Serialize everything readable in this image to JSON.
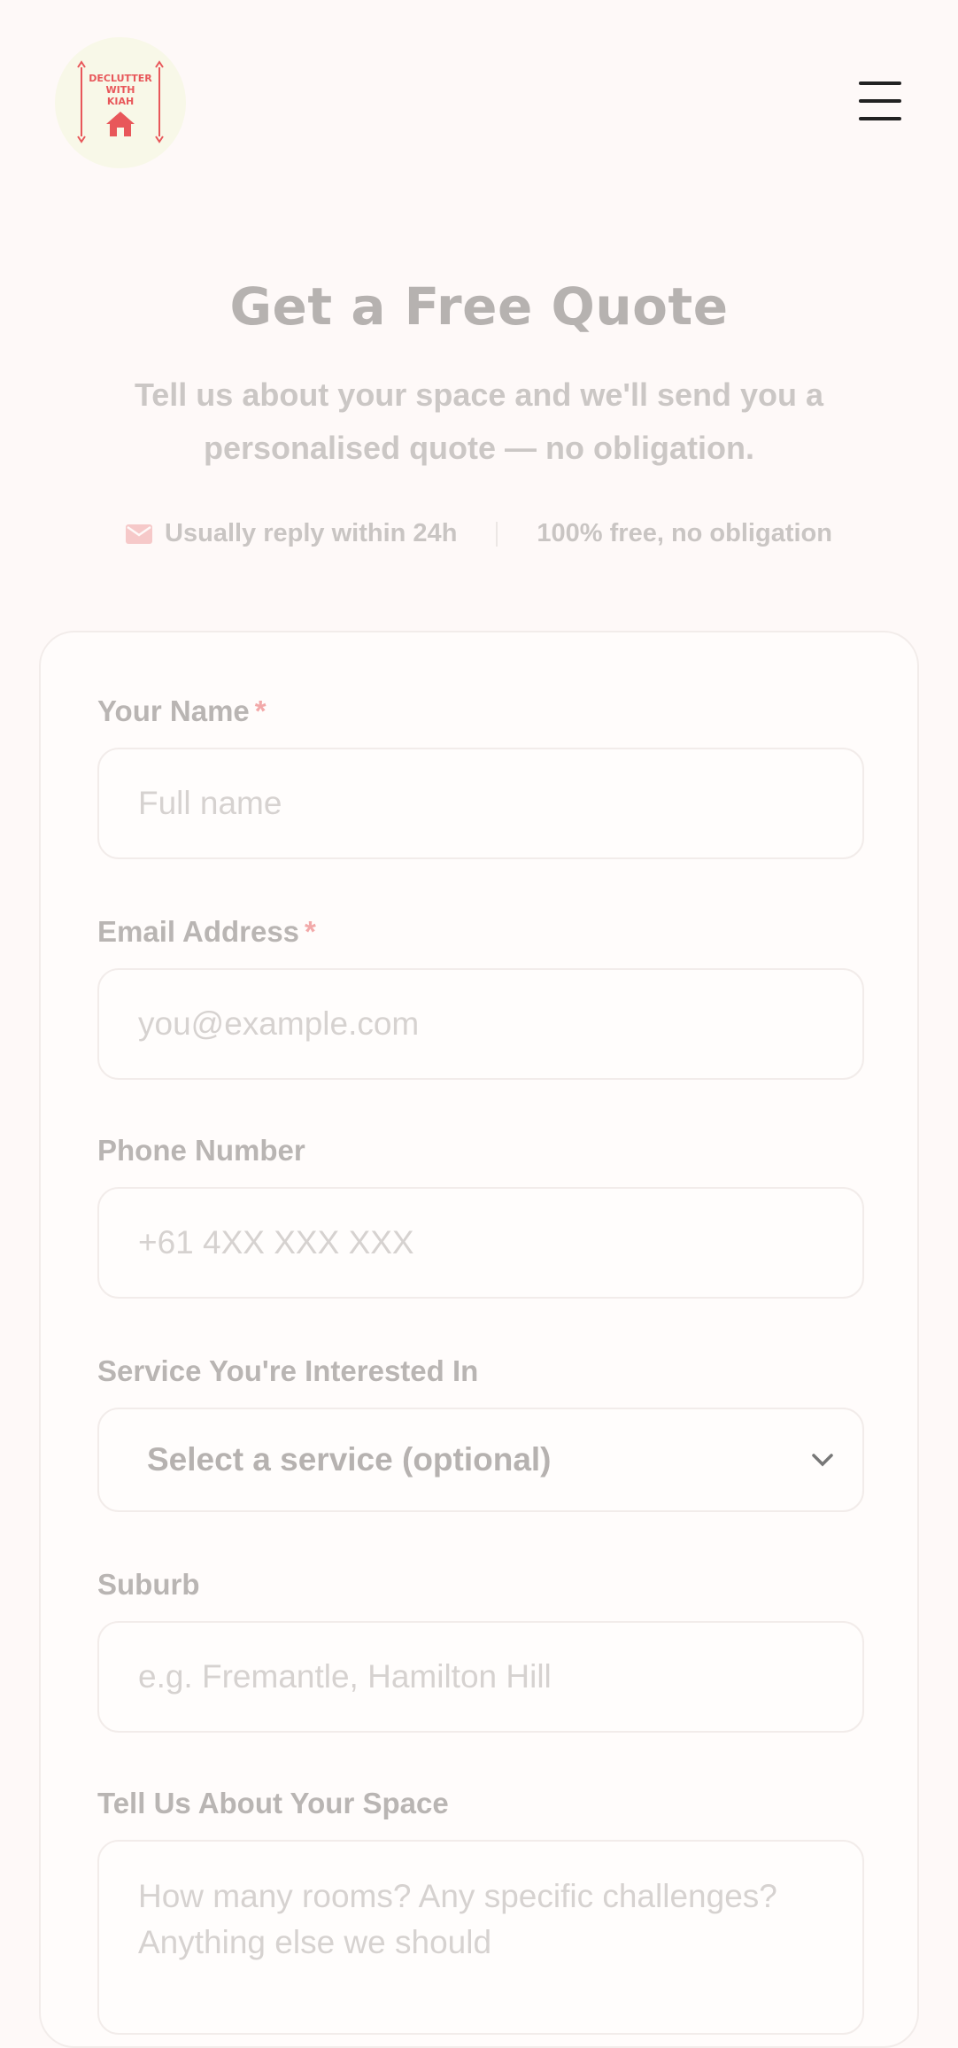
{
  "header": {
    "logo_lines": [
      "DECLUTTER",
      "WITH",
      "KIAH"
    ],
    "menu_icon": "hamburger-icon"
  },
  "hero": {
    "title": "Get a Free Quote",
    "subtitle": "Tell us about your space and we'll send you a personalised quote — no obligation."
  },
  "badges": {
    "reply": "Usually reply within 24h",
    "free": "100% free, no obligation"
  },
  "form": {
    "name": {
      "label": "Your Name",
      "required": "*",
      "placeholder": "Full name"
    },
    "email": {
      "label": "Email Address",
      "required": "*",
      "placeholder": "you@example.com"
    },
    "phone": {
      "label": "Phone Number",
      "placeholder": "+61 4XX XXX XXX"
    },
    "service": {
      "label": "Service You're Interested In",
      "selected": "Select a service (optional)"
    },
    "suburb": {
      "label": "Suburb",
      "placeholder": "e.g. Fremantle, Hamilton Hill"
    },
    "space": {
      "label": "Tell Us About Your Space",
      "placeholder": "How many rooms? Any specific challenges? Anything else we should"
    }
  },
  "colors": {
    "accent": "#e8575a",
    "background": "#fef9f8",
    "logo_bg": "#f8f8e8"
  }
}
